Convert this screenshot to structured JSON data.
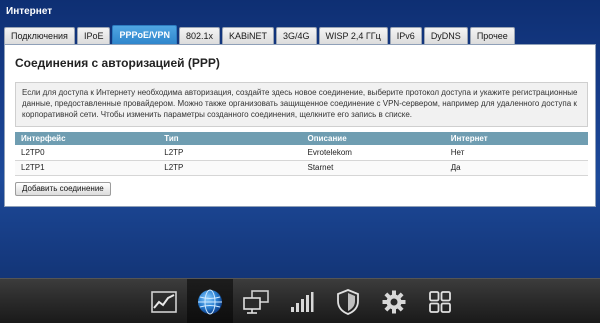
{
  "window": {
    "title": "Интернет"
  },
  "tabs": [
    {
      "label": "Подключения",
      "active": false
    },
    {
      "label": "IPoE",
      "active": false
    },
    {
      "label": "PPPoE/VPN",
      "active": true
    },
    {
      "label": "802.1x",
      "active": false
    },
    {
      "label": "KABiNET",
      "active": false
    },
    {
      "label": "3G/4G",
      "active": false
    },
    {
      "label": "WISP 2,4 ГГц",
      "active": false
    },
    {
      "label": "IPv6",
      "active": false
    },
    {
      "label": "DyDNS",
      "active": false
    },
    {
      "label": "Прочее",
      "active": false
    }
  ],
  "panel": {
    "title": "Соединения с авторизацией (PPP)",
    "info": "Если для доступа к Интернету необходима авторизация, создайте здесь новое соединение, выберите протокол доступа и укажите регистрационные данные, предоставленные провайдером. Можно также организовать защищенное соединение с VPN-сервером, например для удаленного доступа к корпоративной сети. Чтобы изменить параметры созданного соединения, щелкните его запись в списке."
  },
  "table": {
    "headers": [
      "Интерфейс",
      "Тип",
      "Описание",
      "Интернет"
    ],
    "rows": [
      [
        "L2TP0",
        "L2TP",
        "Evrotelekom",
        "Нет"
      ],
      [
        "L2TP1",
        "L2TP",
        "Starnet",
        "Да"
      ]
    ]
  },
  "buttons": {
    "add_connection": "Добавить соединение"
  },
  "bottom_nav": [
    {
      "icon": "chart-icon",
      "active": false
    },
    {
      "icon": "globe-icon",
      "active": true
    },
    {
      "icon": "network-icon",
      "active": false
    },
    {
      "icon": "signal-bars-icon",
      "active": false
    },
    {
      "icon": "shield-icon",
      "active": false
    },
    {
      "icon": "gear-icon",
      "active": false
    },
    {
      "icon": "grid-icon",
      "active": false
    }
  ],
  "colors": {
    "background": "#1d4a9a",
    "tab_active": "#3a8fd3",
    "table_header": "#6f9db1",
    "bottom_bar": "#2a2a2a"
  }
}
